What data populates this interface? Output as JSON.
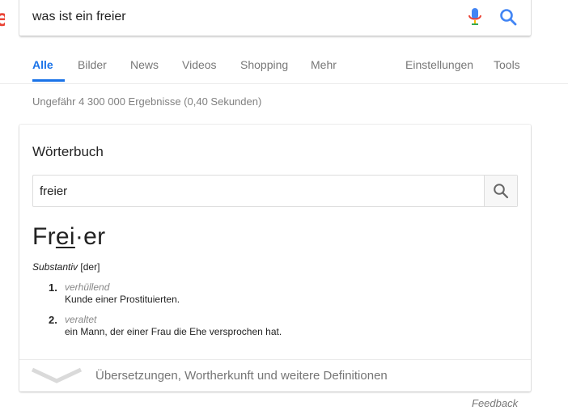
{
  "search": {
    "query": "was ist ein freier"
  },
  "tabs": [
    {
      "label": "Alle",
      "active": true
    },
    {
      "label": "Bilder"
    },
    {
      "label": "News"
    },
    {
      "label": "Videos"
    },
    {
      "label": "Shopping"
    },
    {
      "label": "Mehr"
    },
    {
      "label": "Einstellungen"
    },
    {
      "label": "Tools"
    }
  ],
  "results_info": "Ungefähr 4 300 000 Ergebnisse (0,40 Sekunden)",
  "dictionary": {
    "title": "Wörterbuch",
    "search_value": "freier",
    "headword": {
      "part1": "Fr",
      "part2": "ei",
      "part3": "·er"
    },
    "pos_label": "Substantiv",
    "gender": "[der]",
    "senses": [
      {
        "num": "1.",
        "register": "verhüllend",
        "definition": "Kunde einer Prostituierten."
      },
      {
        "num": "2.",
        "register": "veraltet",
        "definition": "ein Mann, der einer Frau die Ehe versprochen hat."
      }
    ],
    "more_label": "Übersetzungen, Wortherkunft und weitere Definitionen"
  },
  "feedback_label": "Feedback",
  "colors": {
    "accent": "#1a73e8",
    "logo_red": "#ea4335"
  },
  "icons": [
    "microphone-icon",
    "search-icon",
    "chevron-down-icon"
  ]
}
